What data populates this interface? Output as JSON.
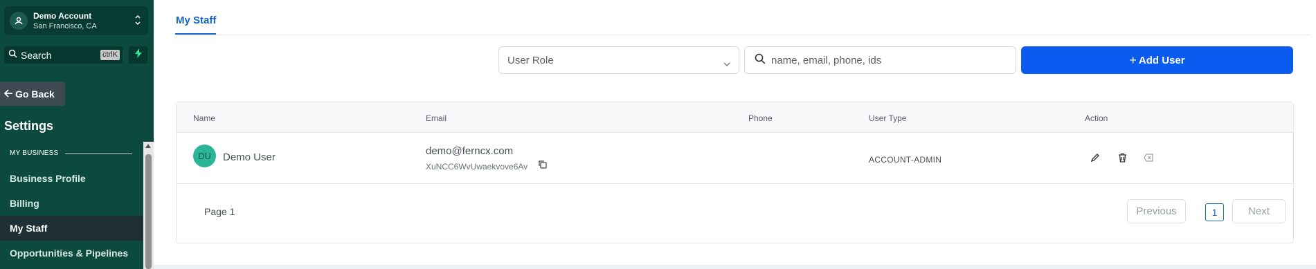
{
  "account": {
    "name": "Demo Account",
    "location": "San Francisco, CA"
  },
  "search": {
    "label": "Search",
    "shortcut": "ctrlK"
  },
  "go_back": "Go Back",
  "settings_title": "Settings",
  "section": "MY BUSINESS",
  "nav": [
    {
      "label": "Business Profile",
      "active": false
    },
    {
      "label": "Billing",
      "active": false
    },
    {
      "label": "My Staff",
      "active": true
    },
    {
      "label": "Opportunities & Pipelines",
      "active": false
    }
  ],
  "tab": "My Staff",
  "filters": {
    "role_placeholder": "User Role",
    "search_placeholder": "name, email, phone, ids",
    "add_user": "Add User"
  },
  "table": {
    "headers": {
      "name": "Name",
      "email": "Email",
      "phone": "Phone",
      "user_type": "User Type",
      "action": "Action"
    },
    "rows": [
      {
        "initials": "DU",
        "name": "Demo User",
        "email": "demo@ferncx.com",
        "id": "XuNCC6WvUwaekvove6Av",
        "phone": "",
        "user_type": "ACCOUNT-ADMIN"
      }
    ]
  },
  "pagination": {
    "label": "Page 1",
    "previous": "Previous",
    "current": "1",
    "next": "Next"
  },
  "colors": {
    "sidebar": "#0c4a40",
    "accent": "#0a5cf0",
    "avatar": "#2bb598"
  }
}
